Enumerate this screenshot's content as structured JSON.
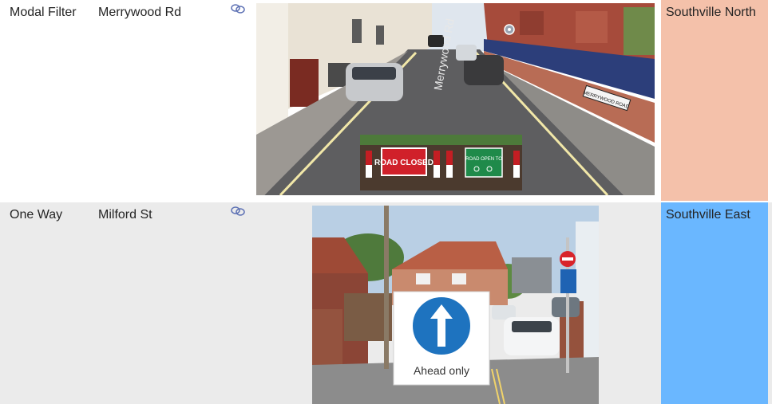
{
  "rows": [
    {
      "type": "Modal Filter",
      "street": "Merrywood Rd",
      "area": "Southville North",
      "area_color": "#f4c1aa",
      "photo": {
        "street_sign": "MERRYWOOD ROAD",
        "road_marking": "Merrywood Rd",
        "barrier_left_sign": "ROAD CLOSED",
        "barrier_right_sign": "ROAD OPEN TO"
      }
    },
    {
      "type": "One Way",
      "street": "Milford St",
      "area": "Southville East",
      "area_color": "#6ab7ff",
      "photo": {
        "sign_caption": "Ahead only"
      }
    }
  ],
  "icons": {
    "link": "link-icon"
  }
}
